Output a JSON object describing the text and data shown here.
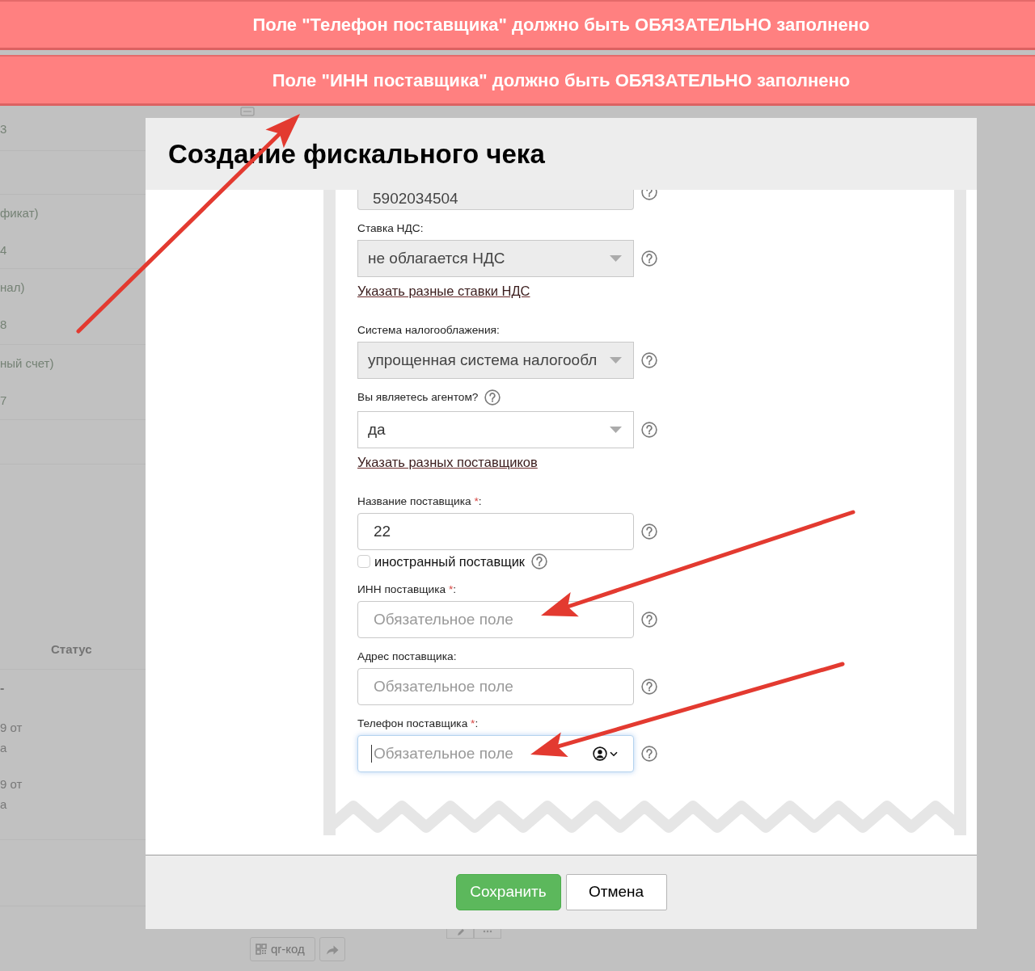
{
  "alerts": [
    {
      "text": "Поле \"Телефон поставщика\" должно быть ОБЯЗАТЕЛЬНО заполнено"
    },
    {
      "text": "Поле \"ИНН поставщика\" должно быть ОБЯЗАТЕЛЬНО заполнено"
    }
  ],
  "background_page": {
    "top_icons": [
      {
        "kind": "card"
      }
    ],
    "rows": [
      {
        "lines": [
          "3"
        ]
      },
      {
        "lines": [
          "фикат)",
          "4"
        ]
      },
      {
        "lines": [
          "нал)",
          "8"
        ]
      },
      {
        "lines": [
          "ный счет)",
          "7"
        ]
      }
    ],
    "column_header": "Статус",
    "rows_below_header": [
      {
        "lines": [
          "-"
        ]
      },
      {
        "lines": [
          "9 от",
          "а"
        ]
      },
      {
        "lines": [
          "9 от",
          "а"
        ]
      }
    ],
    "buttons": [
      {
        "kind": "qr",
        "label": "qr-код"
      },
      {
        "kind": "share"
      }
    ],
    "peek_buttons": [
      {
        "kind": "edit"
      },
      {
        "kind": "more"
      }
    ]
  },
  "dialog": {
    "title": "Создание фискального чека",
    "form": {
      "fields": [
        {
          "kind": "partial_input",
          "value": "5902034504",
          "disabled": true,
          "help_icon": true
        },
        {
          "kind": "select",
          "label": "Ставка НДС:",
          "value": "не облагается НДС",
          "disabled": true,
          "help_icon": true,
          "link": "Указать разные ставки НДС"
        },
        {
          "kind": "select",
          "label": "Система налогооблажения:",
          "value": "упрощенная система налогообл",
          "disabled": true,
          "help_icon": true
        },
        {
          "kind": "select",
          "label": "Вы являетесь агентом?",
          "label_help_icon": true,
          "value": "да",
          "disabled": false,
          "help_icon": true,
          "link": "Указать разных поставщиков"
        },
        {
          "kind": "input",
          "label": "Название поставщика",
          "required_mark": "*",
          "label_suffix": ":",
          "value": "22",
          "focused": false,
          "help_icon": true
        },
        {
          "kind": "checkbox",
          "label": "иностранный поставщик",
          "checked": false,
          "help_icon": true
        },
        {
          "kind": "input",
          "label": "ИНН поставщика",
          "required_mark": "*",
          "label_suffix": ":",
          "placeholder": "Обязательное поле",
          "focused": false,
          "help_icon": true
        },
        {
          "kind": "input",
          "label": "Адрес поставщика:",
          "placeholder": "Обязательное поле",
          "focused": false,
          "help_icon": true
        },
        {
          "kind": "input",
          "label": "Телефон поставщика",
          "required_mark": "*",
          "label_suffix": ":",
          "placeholder": "Обязательное поле",
          "focused": true,
          "autofill_icon": true,
          "help_icon": true
        }
      ]
    },
    "buttons": [
      {
        "label": "Сохранить",
        "kind": "primary"
      },
      {
        "label": "Отмена",
        "kind": "secondary"
      }
    ]
  },
  "annotations": [
    {
      "kind": "arrow"
    },
    {
      "kind": "arrow"
    },
    {
      "kind": "arrow"
    }
  ]
}
